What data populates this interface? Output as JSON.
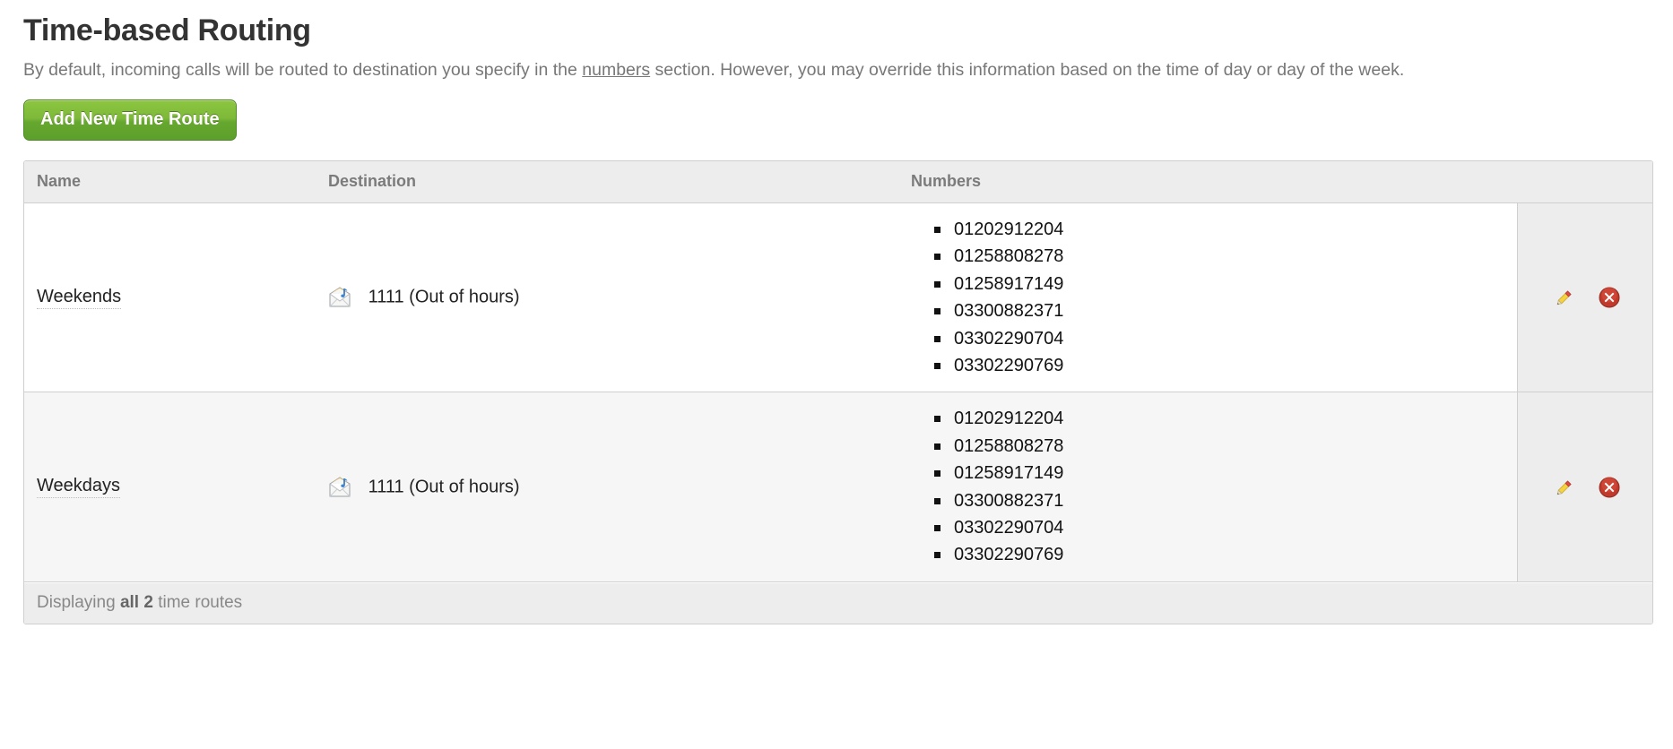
{
  "page": {
    "title": "Time-based Routing",
    "description_before": "By default, incoming calls will be routed to destination you specify in the ",
    "description_link": "numbers",
    "description_after": " section. However, you may override this information based on the time of day or day of the week."
  },
  "toolbar": {
    "add_label": "Add New Time Route",
    "add_color": "#7eb93a"
  },
  "table": {
    "headers": {
      "name": "Name",
      "destination": "Destination",
      "numbers": "Numbers",
      "actions": ""
    },
    "rows": [
      {
        "name": "Weekends",
        "destination_icon": "voicemail-greeting-icon",
        "destination": "1111 (Out of hours)",
        "numbers": [
          "01202912204",
          "01258808278",
          "01258917149",
          "03300882371",
          "03302290704",
          "03302290769"
        ],
        "edit_icon": "pencil-icon",
        "delete_icon": "delete-circle-icon"
      },
      {
        "name": "Weekdays",
        "destination_icon": "voicemail-greeting-icon",
        "destination": "1111 (Out of hours)",
        "numbers": [
          "01202912204",
          "01258808278",
          "01258917149",
          "03300882371",
          "03302290704",
          "03302290769"
        ],
        "edit_icon": "pencil-icon",
        "delete_icon": "delete-circle-icon"
      }
    ],
    "footer": {
      "prefix": "Displaying ",
      "count": "all 2",
      "suffix": " time routes"
    }
  }
}
